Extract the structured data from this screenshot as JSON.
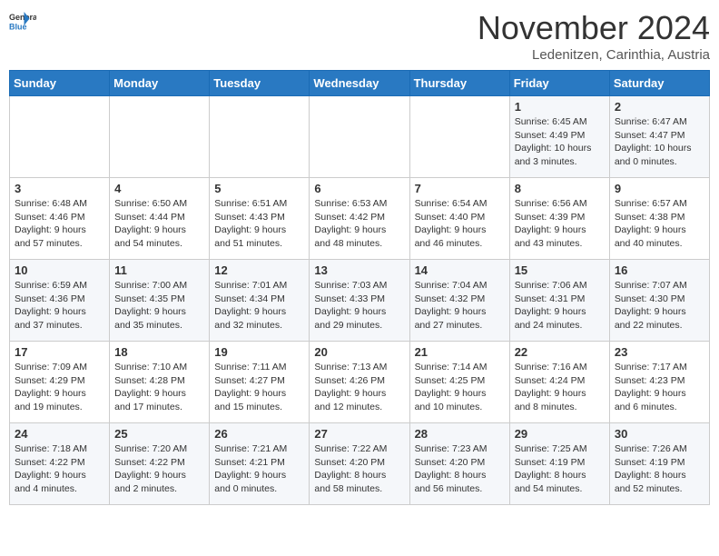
{
  "logo": {
    "line1": "General",
    "line2": "Blue"
  },
  "title": "November 2024",
  "location": "Ledenitzen, Carinthia, Austria",
  "days_of_week": [
    "Sunday",
    "Monday",
    "Tuesday",
    "Wednesday",
    "Thursday",
    "Friday",
    "Saturday"
  ],
  "weeks": [
    [
      {
        "day": "",
        "sunrise": "",
        "sunset": "",
        "daylight": ""
      },
      {
        "day": "",
        "sunrise": "",
        "sunset": "",
        "daylight": ""
      },
      {
        "day": "",
        "sunrise": "",
        "sunset": "",
        "daylight": ""
      },
      {
        "day": "",
        "sunrise": "",
        "sunset": "",
        "daylight": ""
      },
      {
        "day": "",
        "sunrise": "",
        "sunset": "",
        "daylight": ""
      },
      {
        "day": "1",
        "sunrise": "Sunrise: 6:45 AM",
        "sunset": "Sunset: 4:49 PM",
        "daylight": "Daylight: 10 hours and 3 minutes."
      },
      {
        "day": "2",
        "sunrise": "Sunrise: 6:47 AM",
        "sunset": "Sunset: 4:47 PM",
        "daylight": "Daylight: 10 hours and 0 minutes."
      }
    ],
    [
      {
        "day": "3",
        "sunrise": "Sunrise: 6:48 AM",
        "sunset": "Sunset: 4:46 PM",
        "daylight": "Daylight: 9 hours and 57 minutes."
      },
      {
        "day": "4",
        "sunrise": "Sunrise: 6:50 AM",
        "sunset": "Sunset: 4:44 PM",
        "daylight": "Daylight: 9 hours and 54 minutes."
      },
      {
        "day": "5",
        "sunrise": "Sunrise: 6:51 AM",
        "sunset": "Sunset: 4:43 PM",
        "daylight": "Daylight: 9 hours and 51 minutes."
      },
      {
        "day": "6",
        "sunrise": "Sunrise: 6:53 AM",
        "sunset": "Sunset: 4:42 PM",
        "daylight": "Daylight: 9 hours and 48 minutes."
      },
      {
        "day": "7",
        "sunrise": "Sunrise: 6:54 AM",
        "sunset": "Sunset: 4:40 PM",
        "daylight": "Daylight: 9 hours and 46 minutes."
      },
      {
        "day": "8",
        "sunrise": "Sunrise: 6:56 AM",
        "sunset": "Sunset: 4:39 PM",
        "daylight": "Daylight: 9 hours and 43 minutes."
      },
      {
        "day": "9",
        "sunrise": "Sunrise: 6:57 AM",
        "sunset": "Sunset: 4:38 PM",
        "daylight": "Daylight: 9 hours and 40 minutes."
      }
    ],
    [
      {
        "day": "10",
        "sunrise": "Sunrise: 6:59 AM",
        "sunset": "Sunset: 4:36 PM",
        "daylight": "Daylight: 9 hours and 37 minutes."
      },
      {
        "day": "11",
        "sunrise": "Sunrise: 7:00 AM",
        "sunset": "Sunset: 4:35 PM",
        "daylight": "Daylight: 9 hours and 35 minutes."
      },
      {
        "day": "12",
        "sunrise": "Sunrise: 7:01 AM",
        "sunset": "Sunset: 4:34 PM",
        "daylight": "Daylight: 9 hours and 32 minutes."
      },
      {
        "day": "13",
        "sunrise": "Sunrise: 7:03 AM",
        "sunset": "Sunset: 4:33 PM",
        "daylight": "Daylight: 9 hours and 29 minutes."
      },
      {
        "day": "14",
        "sunrise": "Sunrise: 7:04 AM",
        "sunset": "Sunset: 4:32 PM",
        "daylight": "Daylight: 9 hours and 27 minutes."
      },
      {
        "day": "15",
        "sunrise": "Sunrise: 7:06 AM",
        "sunset": "Sunset: 4:31 PM",
        "daylight": "Daylight: 9 hours and 24 minutes."
      },
      {
        "day": "16",
        "sunrise": "Sunrise: 7:07 AM",
        "sunset": "Sunset: 4:30 PM",
        "daylight": "Daylight: 9 hours and 22 minutes."
      }
    ],
    [
      {
        "day": "17",
        "sunrise": "Sunrise: 7:09 AM",
        "sunset": "Sunset: 4:29 PM",
        "daylight": "Daylight: 9 hours and 19 minutes."
      },
      {
        "day": "18",
        "sunrise": "Sunrise: 7:10 AM",
        "sunset": "Sunset: 4:28 PM",
        "daylight": "Daylight: 9 hours and 17 minutes."
      },
      {
        "day": "19",
        "sunrise": "Sunrise: 7:11 AM",
        "sunset": "Sunset: 4:27 PM",
        "daylight": "Daylight: 9 hours and 15 minutes."
      },
      {
        "day": "20",
        "sunrise": "Sunrise: 7:13 AM",
        "sunset": "Sunset: 4:26 PM",
        "daylight": "Daylight: 9 hours and 12 minutes."
      },
      {
        "day": "21",
        "sunrise": "Sunrise: 7:14 AM",
        "sunset": "Sunset: 4:25 PM",
        "daylight": "Daylight: 9 hours and 10 minutes."
      },
      {
        "day": "22",
        "sunrise": "Sunrise: 7:16 AM",
        "sunset": "Sunset: 4:24 PM",
        "daylight": "Daylight: 9 hours and 8 minutes."
      },
      {
        "day": "23",
        "sunrise": "Sunrise: 7:17 AM",
        "sunset": "Sunset: 4:23 PM",
        "daylight": "Daylight: 9 hours and 6 minutes."
      }
    ],
    [
      {
        "day": "24",
        "sunrise": "Sunrise: 7:18 AM",
        "sunset": "Sunset: 4:22 PM",
        "daylight": "Daylight: 9 hours and 4 minutes."
      },
      {
        "day": "25",
        "sunrise": "Sunrise: 7:20 AM",
        "sunset": "Sunset: 4:22 PM",
        "daylight": "Daylight: 9 hours and 2 minutes."
      },
      {
        "day": "26",
        "sunrise": "Sunrise: 7:21 AM",
        "sunset": "Sunset: 4:21 PM",
        "daylight": "Daylight: 9 hours and 0 minutes."
      },
      {
        "day": "27",
        "sunrise": "Sunrise: 7:22 AM",
        "sunset": "Sunset: 4:20 PM",
        "daylight": "Daylight: 8 hours and 58 minutes."
      },
      {
        "day": "28",
        "sunrise": "Sunrise: 7:23 AM",
        "sunset": "Sunset: 4:20 PM",
        "daylight": "Daylight: 8 hours and 56 minutes."
      },
      {
        "day": "29",
        "sunrise": "Sunrise: 7:25 AM",
        "sunset": "Sunset: 4:19 PM",
        "daylight": "Daylight: 8 hours and 54 minutes."
      },
      {
        "day": "30",
        "sunrise": "Sunrise: 7:26 AM",
        "sunset": "Sunset: 4:19 PM",
        "daylight": "Daylight: 8 hours and 52 minutes."
      }
    ]
  ]
}
